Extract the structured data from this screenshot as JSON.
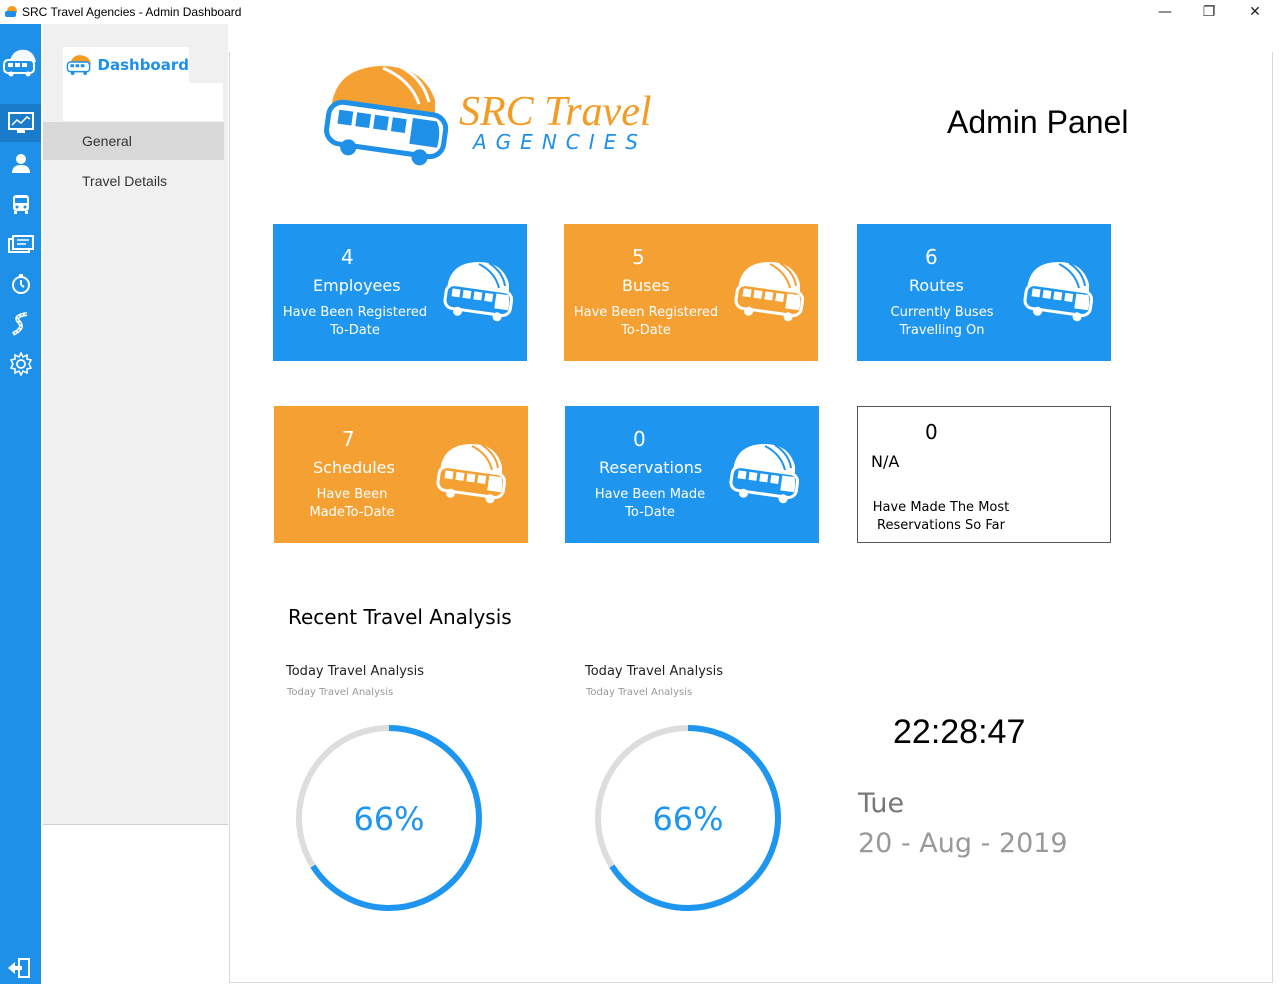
{
  "window": {
    "title": "SRC Travel Agencies - Admin Dashboard",
    "minimize_glyph": "—",
    "restore_glyph": "❐",
    "close_glyph": "✕"
  },
  "sidebar": {
    "icons": [
      "monitor-chart-icon",
      "user-icon",
      "bus-icon",
      "ticket-icon",
      "stopwatch-icon",
      "road-icon",
      "gear-icon"
    ],
    "active_index": 0
  },
  "subnav": {
    "brand_label": "Dashboard",
    "items": [
      {
        "label": "General",
        "selected": true
      },
      {
        "label": "Travel Details",
        "selected": false
      }
    ]
  },
  "logo": {
    "line1": "SRC Travel",
    "line2": "AGENCIES"
  },
  "header": {
    "title": "Admin Panel"
  },
  "cards": [
    {
      "number": "4",
      "name": "Employees",
      "desc1": "Have Been Registered",
      "desc2": "To-Date",
      "color": "#1E96F0"
    },
    {
      "number": "5",
      "name": "Buses",
      "desc1": "Have Been Registered",
      "desc2": "To-Date",
      "color": "#F5A033"
    },
    {
      "number": "6",
      "name": "Routes",
      "desc1": "Currently Buses",
      "desc2": "Travelling On",
      "color": "#1E96F0"
    },
    {
      "number": "7",
      "name": "Schedules",
      "desc1": "Have Been",
      "desc2": "MadeTo-Date",
      "color": "#F5A033"
    },
    {
      "number": "0",
      "name": "Reservations",
      "desc1": "Have Been Made",
      "desc2": "To-Date",
      "color": "#1E96F0"
    },
    {
      "number": "0",
      "name": "N/A",
      "desc1": "Have Made The Most",
      "desc2": "Reservations So Far",
      "color": "#FFFFFF"
    }
  ],
  "analysis": {
    "section_title": "Recent Travel Analysis",
    "gauges": [
      {
        "title": "Today Travel Analysis",
        "subtitle": "Today Travel Analysis",
        "percent_label": "66%",
        "fraction": 0.66
      },
      {
        "title": "Today Travel Analysis",
        "subtitle": "Today Travel Analysis",
        "percent_label": "66%",
        "fraction": 0.66
      }
    ]
  },
  "clock": {
    "time": "22:28:47",
    "day": "Tue",
    "date": "20 - Aug - 2019"
  },
  "colors": {
    "accent_blue": "#1E90E8",
    "accent_orange": "#F39C23",
    "gauge_track": "#DDDDDD"
  }
}
